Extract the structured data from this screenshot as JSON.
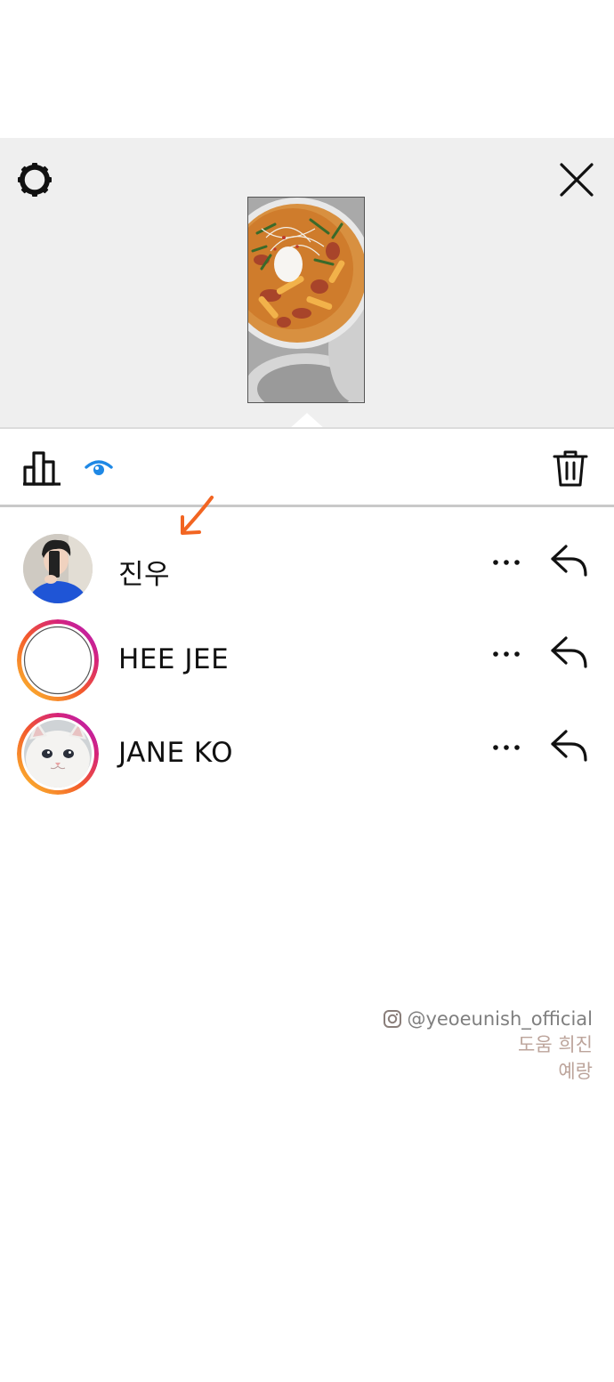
{
  "header": {
    "settings_icon": "gear-icon",
    "close_icon": "close-icon",
    "background": "#efefef"
  },
  "story": {
    "thumbnail": "food-dish-image"
  },
  "toolbar": {
    "insights_icon": "bar-chart-icon",
    "views_icon": "eye-icon",
    "views_color": "#1e88e5",
    "delete_icon": "trash-icon"
  },
  "viewers": [
    {
      "name": "진우",
      "has_story_ring": false
    },
    {
      "name": "HEE JEE",
      "has_story_ring": true
    },
    {
      "name": "JANE KO",
      "has_story_ring": true
    }
  ],
  "annotation": {
    "color": "#f26522"
  },
  "credit": {
    "handle": "@yeoeunish_official",
    "line2": "도움 희진",
    "line3": "예랑"
  }
}
